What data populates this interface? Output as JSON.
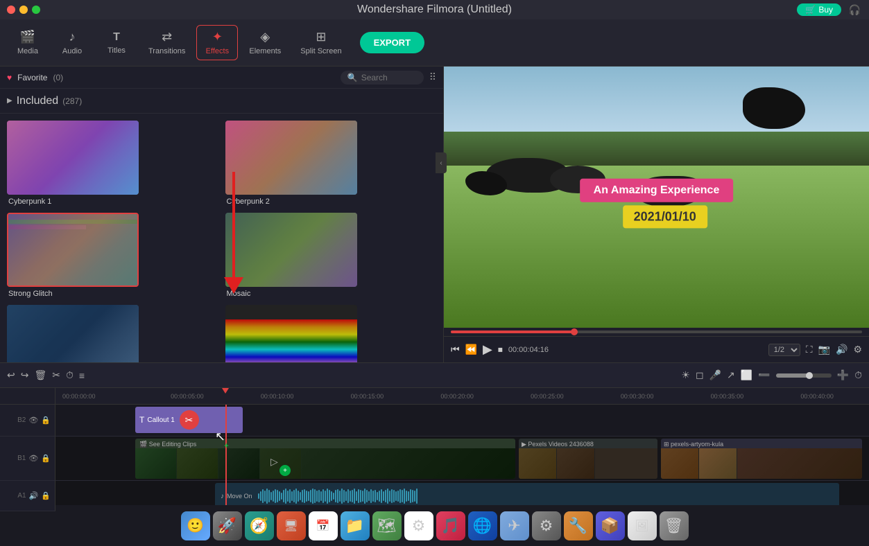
{
  "titlebar": {
    "title": "Wondershare Filmora (Untitled)",
    "buy_label": "Buy"
  },
  "toolbar": {
    "items": [
      {
        "id": "media",
        "label": "Media",
        "icon": "🎬"
      },
      {
        "id": "audio",
        "label": "Audio",
        "icon": "🎵"
      },
      {
        "id": "titles",
        "label": "Titles",
        "icon": "T"
      },
      {
        "id": "transitions",
        "label": "Transitions",
        "icon": "↔"
      },
      {
        "id": "effects",
        "label": "Effects",
        "icon": "✦"
      },
      {
        "id": "elements",
        "label": "Elements",
        "icon": "◈"
      },
      {
        "id": "split-screen",
        "label": "Split Screen",
        "icon": "⊞"
      }
    ],
    "export_label": "EXPORT"
  },
  "left_panel": {
    "favorite": {
      "label": "Favorite",
      "count": "(0)"
    },
    "search": {
      "placeholder": "Search"
    },
    "tree": {
      "label": "Included",
      "count": "(287)"
    },
    "effects": [
      {
        "id": "cyberpunk1",
        "label": "Cyberpunk 1",
        "selected": false
      },
      {
        "id": "cyberpunk2",
        "label": "Cyberpunk 2",
        "selected": false
      },
      {
        "id": "strongglitch",
        "label": "Strong Glitch",
        "selected": true
      },
      {
        "id": "mosaic",
        "label": "Mosaic",
        "selected": false
      },
      {
        "id": "effect5",
        "label": "",
        "selected": false
      },
      {
        "id": "effect6",
        "label": "",
        "selected": false
      }
    ]
  },
  "preview": {
    "overlay_text_amazing": "An Amazing Experience",
    "overlay_text_date": "2021/01/10",
    "time_current": "00:00:04:16",
    "speed": "1/2"
  },
  "timeline": {
    "toolbar_icons": [
      "↩",
      "↪",
      "🗑",
      "✂",
      "⏱",
      "≡"
    ],
    "ruler_marks": [
      "00:00:00:00",
      "00:00:05:00",
      "00:00:10:00",
      "00:00:15:00",
      "00:00:20:00",
      "00:00:25:00",
      "00:00:30:00",
      "00:00:35:00",
      "00:00:40:00"
    ],
    "tracks": [
      {
        "num": "2",
        "type": "text",
        "clip_label": "Callout 1"
      },
      {
        "num": "1",
        "type": "video"
      },
      {
        "num": "1",
        "type": "audio",
        "clip_label": "Move On"
      }
    ],
    "clips": {
      "callout1": "Callout 1",
      "video_pexels1": "Pexels Videos 2436088",
      "video_pexels2": "pexels-artyom-kula",
      "audio": "Move On"
    }
  },
  "dock": {
    "items": [
      {
        "label": "Finder",
        "emoji": "😊"
      },
      {
        "label": "Rocket",
        "emoji": "🚀"
      },
      {
        "label": "Safari",
        "emoji": "🧭"
      },
      {
        "label": "App4",
        "emoji": "🖥"
      },
      {
        "label": "Calendar",
        "emoji": "📅"
      },
      {
        "label": "Files",
        "emoji": "📁"
      },
      {
        "label": "Maps",
        "emoji": "🗺"
      },
      {
        "label": "Chrome",
        "emoji": "⚙"
      },
      {
        "label": "Music",
        "emoji": "🎵"
      },
      {
        "label": "Safari2",
        "emoji": "🌐"
      },
      {
        "label": "App11",
        "emoji": "✈"
      },
      {
        "label": "Settings",
        "emoji": "⚙"
      },
      {
        "label": "App13",
        "emoji": "🔧"
      },
      {
        "label": "App14",
        "emoji": "📦"
      },
      {
        "label": "Photos",
        "emoji": "🖼"
      },
      {
        "label": "Trash",
        "emoji": "🗑"
      }
    ]
  }
}
